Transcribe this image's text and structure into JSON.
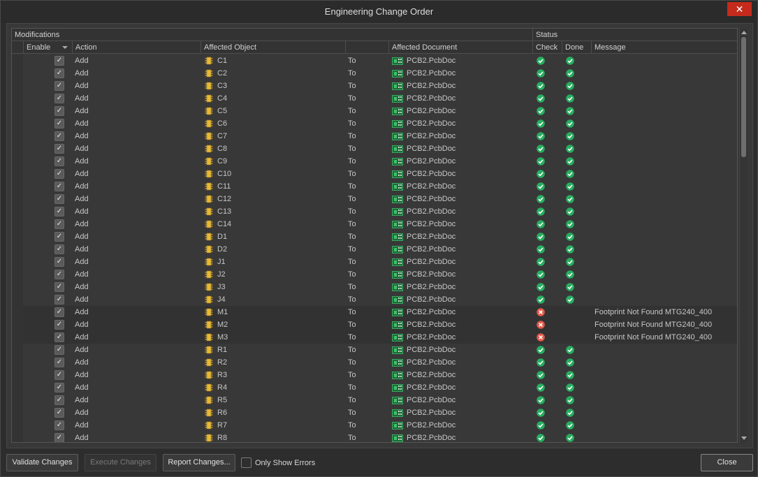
{
  "window": {
    "title": "Engineering Change Order",
    "close_glyph": "✕"
  },
  "grid": {
    "group_headers": {
      "modifications": "Modifications",
      "status": "Status"
    },
    "columns": {
      "enable": "Enable",
      "action": "Action",
      "affected_object": "Affected Object",
      "affected_document": "Affected Document",
      "check": "Check",
      "done": "Done",
      "message": "Message"
    },
    "rows": [
      {
        "action": "Add",
        "object": "C1",
        "to": "To",
        "document": "PCB2.PcbDoc",
        "check": "ok",
        "done": "ok",
        "message": ""
      },
      {
        "action": "Add",
        "object": "C2",
        "to": "To",
        "document": "PCB2.PcbDoc",
        "check": "ok",
        "done": "ok",
        "message": ""
      },
      {
        "action": "Add",
        "object": "C3",
        "to": "To",
        "document": "PCB2.PcbDoc",
        "check": "ok",
        "done": "ok",
        "message": ""
      },
      {
        "action": "Add",
        "object": "C4",
        "to": "To",
        "document": "PCB2.PcbDoc",
        "check": "ok",
        "done": "ok",
        "message": ""
      },
      {
        "action": "Add",
        "object": "C5",
        "to": "To",
        "document": "PCB2.PcbDoc",
        "check": "ok",
        "done": "ok",
        "message": ""
      },
      {
        "action": "Add",
        "object": "C6",
        "to": "To",
        "document": "PCB2.PcbDoc",
        "check": "ok",
        "done": "ok",
        "message": ""
      },
      {
        "action": "Add",
        "object": "C7",
        "to": "To",
        "document": "PCB2.PcbDoc",
        "check": "ok",
        "done": "ok",
        "message": ""
      },
      {
        "action": "Add",
        "object": "C8",
        "to": "To",
        "document": "PCB2.PcbDoc",
        "check": "ok",
        "done": "ok",
        "message": ""
      },
      {
        "action": "Add",
        "object": "C9",
        "to": "To",
        "document": "PCB2.PcbDoc",
        "check": "ok",
        "done": "ok",
        "message": ""
      },
      {
        "action": "Add",
        "object": "C10",
        "to": "To",
        "document": "PCB2.PcbDoc",
        "check": "ok",
        "done": "ok",
        "message": ""
      },
      {
        "action": "Add",
        "object": "C11",
        "to": "To",
        "document": "PCB2.PcbDoc",
        "check": "ok",
        "done": "ok",
        "message": ""
      },
      {
        "action": "Add",
        "object": "C12",
        "to": "To",
        "document": "PCB2.PcbDoc",
        "check": "ok",
        "done": "ok",
        "message": ""
      },
      {
        "action": "Add",
        "object": "C13",
        "to": "To",
        "document": "PCB2.PcbDoc",
        "check": "ok",
        "done": "ok",
        "message": ""
      },
      {
        "action": "Add",
        "object": "C14",
        "to": "To",
        "document": "PCB2.PcbDoc",
        "check": "ok",
        "done": "ok",
        "message": ""
      },
      {
        "action": "Add",
        "object": "D1",
        "to": "To",
        "document": "PCB2.PcbDoc",
        "check": "ok",
        "done": "ok",
        "message": ""
      },
      {
        "action": "Add",
        "object": "D2",
        "to": "To",
        "document": "PCB2.PcbDoc",
        "check": "ok",
        "done": "ok",
        "message": ""
      },
      {
        "action": "Add",
        "object": "J1",
        "to": "To",
        "document": "PCB2.PcbDoc",
        "check": "ok",
        "done": "ok",
        "message": ""
      },
      {
        "action": "Add",
        "object": "J2",
        "to": "To",
        "document": "PCB2.PcbDoc",
        "check": "ok",
        "done": "ok",
        "message": ""
      },
      {
        "action": "Add",
        "object": "J3",
        "to": "To",
        "document": "PCB2.PcbDoc",
        "check": "ok",
        "done": "ok",
        "message": ""
      },
      {
        "action": "Add",
        "object": "J4",
        "to": "To",
        "document": "PCB2.PcbDoc",
        "check": "ok",
        "done": "ok",
        "message": ""
      },
      {
        "action": "Add",
        "object": "M1",
        "to": "To",
        "document": "PCB2.PcbDoc",
        "check": "error",
        "done": "none",
        "message": "Footprint Not Found MTG240_400"
      },
      {
        "action": "Add",
        "object": "M2",
        "to": "To",
        "document": "PCB2.PcbDoc",
        "check": "error",
        "done": "none",
        "message": "Footprint Not Found MTG240_400"
      },
      {
        "action": "Add",
        "object": "M3",
        "to": "To",
        "document": "PCB2.PcbDoc",
        "check": "error",
        "done": "none",
        "message": "Footprint Not Found MTG240_400"
      },
      {
        "action": "Add",
        "object": "R1",
        "to": "To",
        "document": "PCB2.PcbDoc",
        "check": "ok",
        "done": "ok",
        "message": ""
      },
      {
        "action": "Add",
        "object": "R2",
        "to": "To",
        "document": "PCB2.PcbDoc",
        "check": "ok",
        "done": "ok",
        "message": ""
      },
      {
        "action": "Add",
        "object": "R3",
        "to": "To",
        "document": "PCB2.PcbDoc",
        "check": "ok",
        "done": "ok",
        "message": ""
      },
      {
        "action": "Add",
        "object": "R4",
        "to": "To",
        "document": "PCB2.PcbDoc",
        "check": "ok",
        "done": "ok",
        "message": ""
      },
      {
        "action": "Add",
        "object": "R5",
        "to": "To",
        "document": "PCB2.PcbDoc",
        "check": "ok",
        "done": "ok",
        "message": ""
      },
      {
        "action": "Add",
        "object": "R6",
        "to": "To",
        "document": "PCB2.PcbDoc",
        "check": "ok",
        "done": "ok",
        "message": ""
      },
      {
        "action": "Add",
        "object": "R7",
        "to": "To",
        "document": "PCB2.PcbDoc",
        "check": "ok",
        "done": "ok",
        "message": ""
      },
      {
        "action": "Add",
        "object": "R8",
        "to": "To",
        "document": "PCB2.PcbDoc",
        "check": "ok",
        "done": "ok",
        "message": ""
      }
    ]
  },
  "footer": {
    "validate": "Validate Changes",
    "execute": "Execute Changes",
    "report": "Report Changes...",
    "only_errors": "Only Show Errors",
    "close": "Close"
  },
  "colors": {
    "ok": "#27ae60",
    "error": "#e05a4a",
    "close_button": "#c42b1c"
  }
}
